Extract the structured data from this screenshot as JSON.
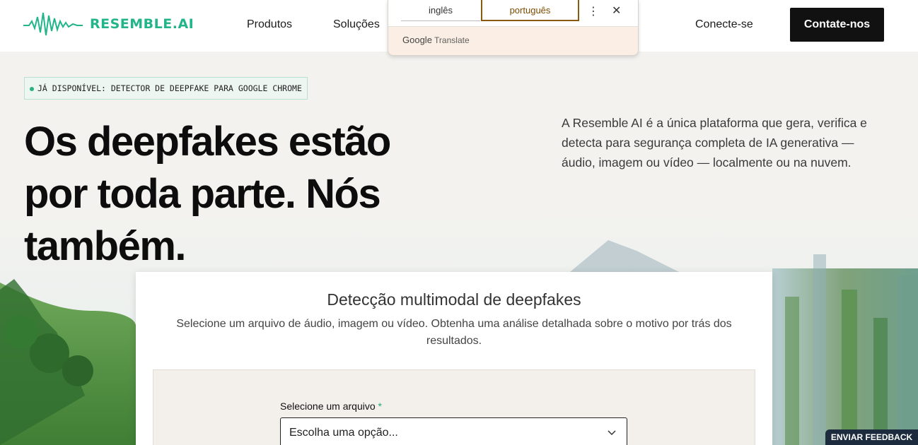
{
  "header": {
    "logo_text": "RESEMBLE.AI",
    "nav": {
      "produtos": "Produtos",
      "solucoes": "Soluções",
      "conecte": "Conecte-se"
    },
    "cta_label": "Contate-nos"
  },
  "translate_popup": {
    "source_lang": "inglês",
    "target_lang": "português",
    "menu_icon": "⋮",
    "close_icon": "✕",
    "brand_google": "Google",
    "brand_translate": "Translate"
  },
  "hero": {
    "badge": "JÁ DISPONÍVEL: DETECTOR DE DEEPFAKE PARA GOOGLE CHROME",
    "title_line1": "Os deepfakes estão",
    "title_line2": "por toda parte. Nós também.",
    "description": "A Resemble AI é a única plataforma que gera, verifica e detecta para segurança completa de IA generativa — áudio, imagem ou vídeo — localmente ou na nuvem."
  },
  "detector_card": {
    "title": "Detecção multimodal de deepfakes",
    "subtitle": "Selecione um arquivo de áudio, imagem ou vídeo. Obtenha uma análise detalhada sobre o motivo por trás dos resultados.",
    "file_label": "Selecione um arquivo",
    "required_mark": "*",
    "select_value": "Escolha uma opção..."
  },
  "feedback_label": "ENVIAR FEEDBACK",
  "colors": {
    "brand": "#22b58a",
    "cta_bg": "#111111",
    "feedback_bg": "#1c2b3e"
  }
}
